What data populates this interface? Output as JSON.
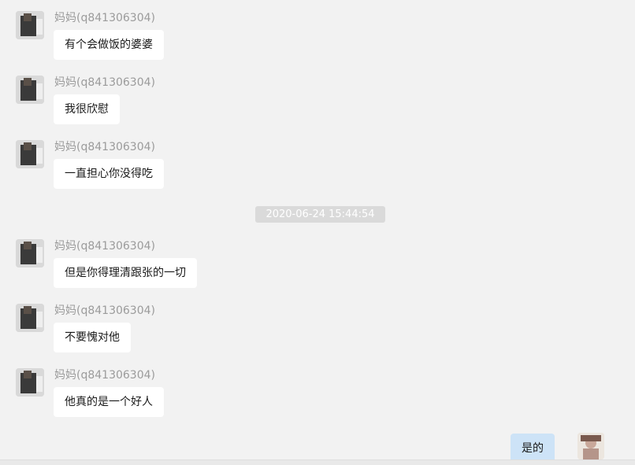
{
  "messages": [
    {
      "sender": "妈妈(q841306304)",
      "text": "有个会做饭的婆婆"
    },
    {
      "sender": "妈妈(q841306304)",
      "text": "我很欣慰"
    },
    {
      "sender": "妈妈(q841306304)",
      "text": "一直担心你没得吃"
    },
    {
      "sender": "妈妈(q841306304)",
      "text": "但是你得理清跟张的一切"
    },
    {
      "sender": "妈妈(q841306304)",
      "text": "不要愧对他"
    },
    {
      "sender": "妈妈(q841306304)",
      "text": "他真的是一个好人"
    }
  ],
  "timestamp": "2020-06-24 15:44:54",
  "self_message": {
    "text": "是的"
  },
  "icons": {
    "contact_avatar": "contact-avatar-photo",
    "self_avatar": "self-avatar-photo"
  }
}
